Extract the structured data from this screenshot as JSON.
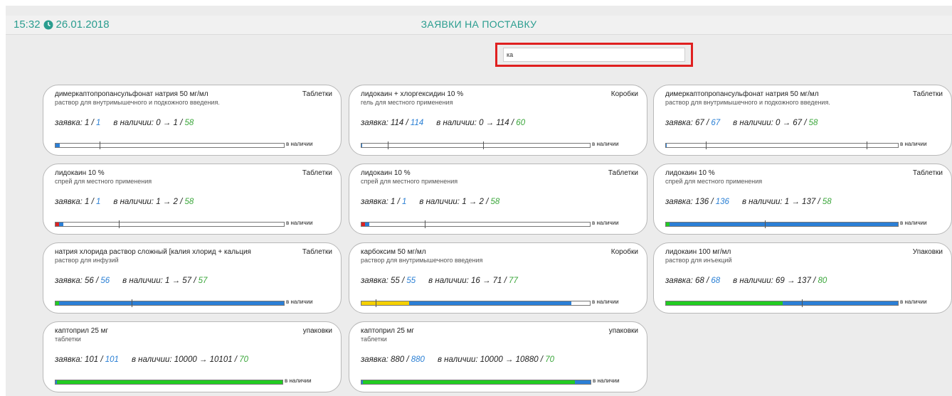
{
  "header": {
    "time": "15:32",
    "date": "26.01.2018",
    "title": "ЗАЯВКИ НА ПОСТАВКУ"
  },
  "search": {
    "value": "ка"
  },
  "colors": {
    "accent": "#2a9d8f",
    "blue": "#2a7fd4",
    "green": "#3aa63a",
    "bar_blue": "#2b7fd6",
    "bar_green": "#22cc22",
    "bar_red": "#dd2222",
    "bar_yellow": "#f5d000",
    "highlight": "#e02020"
  },
  "stock_label": "в наличии",
  "cards": [
    {
      "name_pre": "димер",
      "name_hl": "ка",
      "name_post": "птопропансульфонат натрия 50 мг/мл",
      "unit": "Таблетки",
      "form": "раствор для внутримышечного и подкожного введения.",
      "order_label": "заявка:",
      "order_a": "1",
      "order_b": "1",
      "stock_text": "в наличии: 0 → 1 /",
      "stock_b": "58"
    },
    {
      "name_pre": "лидо",
      "name_hl": "ка",
      "name_post": "ин + хлоргексидин 10 %",
      "unit": "Коробки",
      "form": "гель для местного применения",
      "order_label": "заявка:",
      "order_a": "114",
      "order_b": "114",
      "stock_text": "в наличии: 0 → 114 /",
      "stock_b": "60"
    },
    {
      "name_pre": "димер",
      "name_hl": "ка",
      "name_post": "птопропансульфонат натрия 50 мг/мл",
      "unit": "Таблетки",
      "form": "раствор для внутримышечного и подкожного введения.",
      "order_label": "заявка:",
      "order_a": "67",
      "order_b": "67",
      "stock_text": "в наличии: 0 → 67 /",
      "stock_b": "58"
    },
    {
      "name_pre": "лидо",
      "name_hl": "ка",
      "name_post": "ин 10 %",
      "unit": "Таблетки",
      "form": "спрей для местного применения",
      "order_label": "заявка:",
      "order_a": "1",
      "order_b": "1",
      "stock_text": "в наличии: 1 → 2 /",
      "stock_b": "58"
    },
    {
      "name_pre": "лидо",
      "name_hl": "ка",
      "name_post": "ин 10 %",
      "unit": "Таблетки",
      "form": "спрей для местного применения",
      "order_label": "заявка:",
      "order_a": "1",
      "order_b": "1",
      "stock_text": "в наличии: 1 → 2 /",
      "stock_b": "58"
    },
    {
      "name_pre": "лидо",
      "name_hl": "ка",
      "name_post": "ин 10 %",
      "unit": "Таблетки",
      "form": "спрей для местного применения",
      "order_label": "заявка:",
      "order_a": "136",
      "order_b": "136",
      "stock_text": "в наличии: 1 → 137 /",
      "stock_b": "58"
    },
    {
      "name_pre": "натрия хлорида раствор сложный [",
      "name_hl": "ка",
      "name_post": "лия хлорид + кальция",
      "unit": "Таблетки",
      "form": "раствор для инфузий",
      "order_label": "заявка:",
      "order_a": "56",
      "order_b": "56",
      "stock_text": "в наличии: 1 → 57 /",
      "stock_b": "57"
    },
    {
      "name_pre": "",
      "name_hl": "ка",
      "name_post": "рбоксим 50 мг/мл",
      "unit": "Коробки",
      "form": "раствор для внутримышечного введения",
      "order_label": "заявка:",
      "order_a": "55",
      "order_b": "55",
      "stock_text": "в наличии: 16 → 71 /",
      "stock_b": "77"
    },
    {
      "name_pre": "лидо",
      "name_hl": "ка",
      "name_post": "ин 100 мг/мл",
      "unit": "Упаковки",
      "form": "раствор для инъекций",
      "order_label": "заявка:",
      "order_a": "68",
      "order_b": "68",
      "stock_text": "в наличии: 69 → 137 /",
      "stock_b": "80"
    },
    {
      "name_pre": "",
      "name_hl": "ка",
      "name_post": "птоприл 25 мг",
      "unit": "упаковки",
      "form": "таблетки",
      "order_label": "заявка:",
      "order_a": "101",
      "order_b": "101",
      "stock_text": "в наличии: 10000 → 10101 /",
      "stock_b": "70"
    },
    {
      "name_pre": "",
      "name_hl": "ка",
      "name_post": "птоприл 25 мг",
      "unit": "упаковки",
      "form": "таблетки",
      "order_label": "заявка:",
      "order_a": "880",
      "order_b": "880",
      "stock_text": "в наличии: 10000 → 10880 /",
      "stock_b": "70"
    }
  ]
}
